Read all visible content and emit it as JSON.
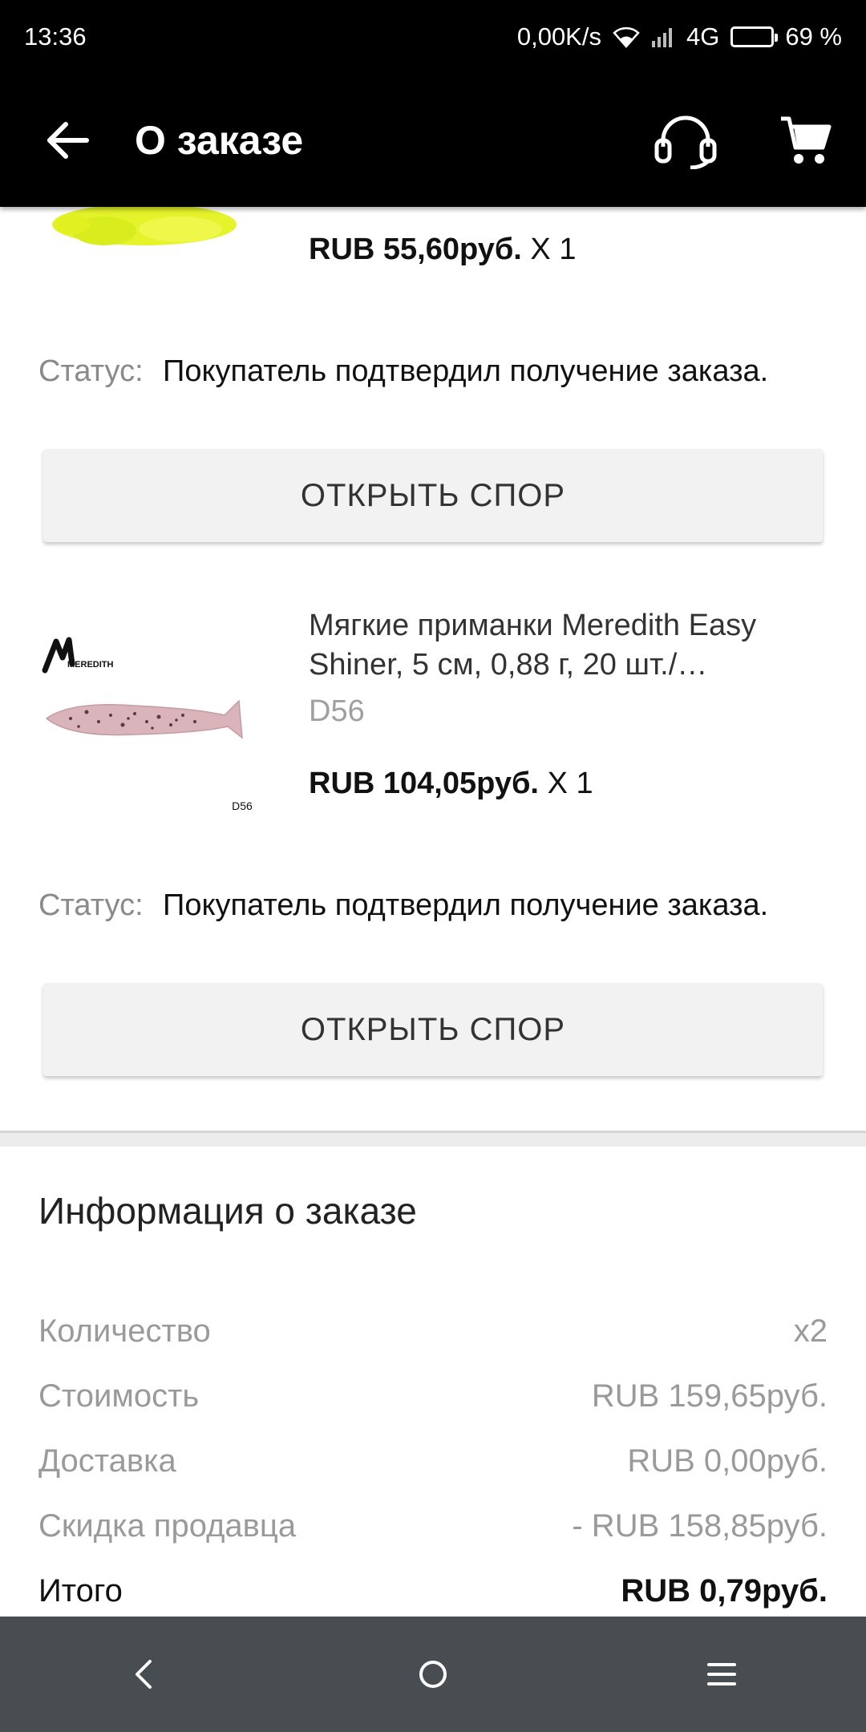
{
  "status_bar": {
    "time": "13:36",
    "net_speed": "0,00K/s",
    "network": "4G",
    "battery": "69 %",
    "battery_level": 0.69
  },
  "app_bar": {
    "title": "О заказе",
    "back_icon": "arrow-left-icon",
    "support_icon": "headset-icon",
    "cart_icon": "cart-icon"
  },
  "items": [
    {
      "price": "RUB 55,60руб.",
      "qty": "X 1",
      "status_label": "Статус:",
      "status": "Покупатель подтвердил получение заказа.",
      "dispute_label": "ОТКРЫТЬ СПОР",
      "thumb_color": "#e4f32a"
    },
    {
      "brand_logo": "MEREDITH",
      "thumb_caption": "D56",
      "title": "Мягкие приманки Meredith Easy Shiner, 5 см, 0,88 г, 20 шт./…",
      "sku": "D56",
      "price": "RUB 104,05руб.",
      "qty": "X 1",
      "status_label": "Статус:",
      "status": "Покупатель подтвердил получение заказа.",
      "dispute_label": "ОТКРЫТЬ СПОР"
    }
  ],
  "order_info": {
    "title": "Информация о заказе",
    "rows": [
      {
        "label": "Количество",
        "value": "x2"
      },
      {
        "label": "Стоимость",
        "value": "RUB 159,65руб."
      },
      {
        "label": "Доставка",
        "value": "RUB 0,00руб."
      },
      {
        "label": "Скидка продавца",
        "value": "- RUB 158,85руб."
      },
      {
        "label": "Итого",
        "value": "RUB 0,79руб."
      }
    ]
  },
  "nav_bar": {
    "back_icon": "nav-back-icon",
    "home_icon": "nav-home-icon",
    "menu_icon": "nav-menu-icon"
  }
}
